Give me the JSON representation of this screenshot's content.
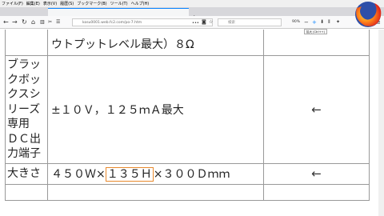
{
  "browser": {
    "menu": [
      "ファイル(F)",
      "編集(E)",
      "表示(V)",
      "履歴(S)",
      "ブックマーク(B)",
      "ツール(T)",
      "ヘルプ(H)"
    ],
    "url": "kosu0001.web.fc2.com/po-7.htm",
    "search_placeholder": "検索",
    "zoom": "90%",
    "tooltip": "拡大 (Ctrl++)"
  },
  "spec_table": {
    "rows": [
      {
        "label": "",
        "value": "ウトプットレベル最大）８Ω",
        "note": ""
      },
      {
        "label": "ブラックボックスシリーズ専用ＤＣ出力端子",
        "label_lines": [
          "ブラッ",
          "クボッ",
          "クスシ",
          "リーズ",
          "専用",
          "ＤＣ出",
          "力端子"
        ],
        "value": "±１０Ｖ，１２５ｍＡ最大",
        "note": "←"
      },
      {
        "label": "大きさ",
        "value_prefix": "４５０Ｗ×",
        "value_highlight": "１３５Ｈ",
        "value_suffix": "×３００Ｄｍｍ",
        "note": "←"
      }
    ]
  }
}
